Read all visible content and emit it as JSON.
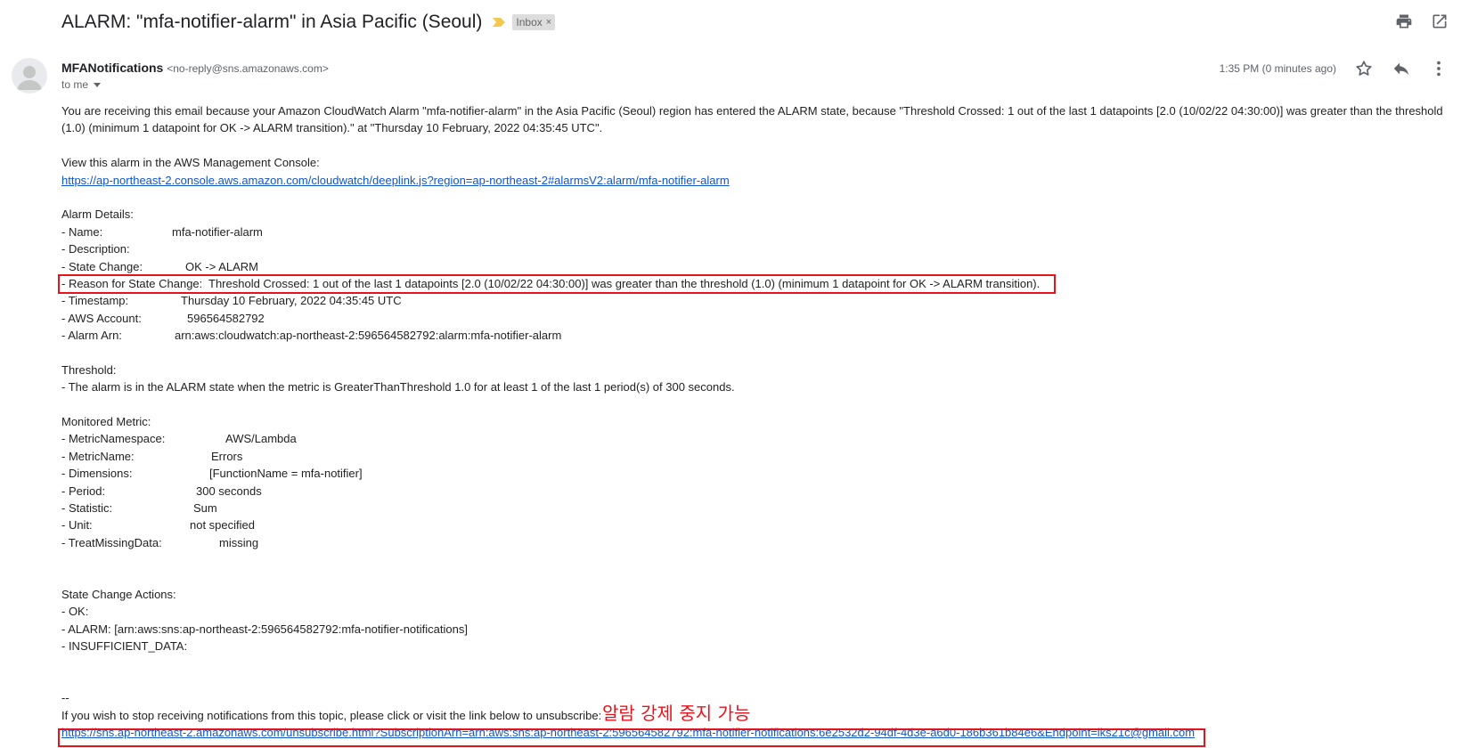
{
  "email": {
    "subject": "ALARM: \"mfa-notifier-alarm\" in Asia Pacific (Seoul)",
    "label": "Inbox",
    "label_close": "×",
    "sender_name": "MFANotifications",
    "sender_email": "<no-reply@sns.amazonaws.com>",
    "to": "to me",
    "time": "1:35 PM (0 minutes ago)"
  },
  "body": {
    "intro": "You are receiving this email because your Amazon CloudWatch Alarm \"mfa-notifier-alarm\" in the Asia Pacific (Seoul) region has entered the ALARM state, because \"Threshold Crossed: 1 out of the last 1 datapoints [2.0 (10/02/22 04:30:00)] was greater than the threshold (1.0) (minimum 1 datapoint for OK -> ALARM transition).\" at \"Thursday 10 February, 2022 04:35:45 UTC\".",
    "view_label": "View this alarm in the AWS Management Console:",
    "console_link": "https://ap-northeast-2.console.aws.amazon.com/cloudwatch/deeplink.js?region=ap-northeast-2#alarmsV2:alarm/mfa-notifier-alarm",
    "alarm_details_heading": "Alarm Details:",
    "alarm_details": [
      {
        "label": "- Name:",
        "value": "mfa-notifier-alarm"
      },
      {
        "label": "- Description:",
        "value": ""
      },
      {
        "label": "- State Change:",
        "value": "OK -> ALARM"
      },
      {
        "label": "- Reason for State Change:",
        "value": "Threshold Crossed: 1 out of the last 1 datapoints [2.0 (10/02/22 04:30:00)] was greater than the threshold (1.0) (minimum 1 datapoint for OK -> ALARM transition)."
      },
      {
        "label": "- Timestamp:",
        "value": "Thursday 10 February, 2022 04:35:45 UTC"
      },
      {
        "label": "- AWS Account:",
        "value": "596564582792"
      },
      {
        "label": "- Alarm Arn:",
        "value": "arn:aws:cloudwatch:ap-northeast-2:596564582792:alarm:mfa-notifier-alarm"
      }
    ],
    "threshold_heading": "Threshold:",
    "threshold_text": "- The alarm is in the ALARM state when the metric is GreaterThanThreshold 1.0 for at least 1 of the last 1 period(s) of 300 seconds.",
    "metric_heading": "Monitored Metric:",
    "metric_details": [
      {
        "label": "- MetricNamespace:",
        "value": "AWS/Lambda"
      },
      {
        "label": "- MetricName:",
        "value": "Errors"
      },
      {
        "label": "- Dimensions:",
        "value": "[FunctionName = mfa-notifier]"
      },
      {
        "label": "- Period:",
        "value": "300 seconds"
      },
      {
        "label": "- Statistic:",
        "value": "Sum"
      },
      {
        "label": "- Unit:",
        "value": "not specified"
      },
      {
        "label": "- TreatMissingData:",
        "value": "missing"
      }
    ],
    "actions_heading": "State Change Actions:",
    "actions": [
      "- OK:",
      "- ALARM: [arn:aws:sns:ap-northeast-2:596564582792:mfa-notifier-notifications]",
      "- INSUFFICIENT_DATA:"
    ],
    "separator": "--",
    "unsubscribe_text": "If you wish to stop receiving notifications from this topic, please click or visit the link below to unsubscribe:",
    "unsubscribe_link": "https://sns.ap-northeast-2.amazonaws.com/unsubscribe.html?SubscriptionArn=arn:aws:sns:ap-northeast-2:596564582792:mfa-notifier-notifications:6e2532d2-94df-4d3e-a6d0-186b361b84e6&Endpoint=lks21c@gmail.com"
  },
  "annotation": {
    "korean_note": "알람 강제 중지 가능",
    "color": "#e8121a"
  },
  "icons": [
    "importance-marker-icon",
    "print-icon",
    "open-in-new-window-icon",
    "avatar-person-icon",
    "star-icon",
    "reply-icon",
    "more-vertical-icon",
    "dropdown-caret-icon"
  ]
}
